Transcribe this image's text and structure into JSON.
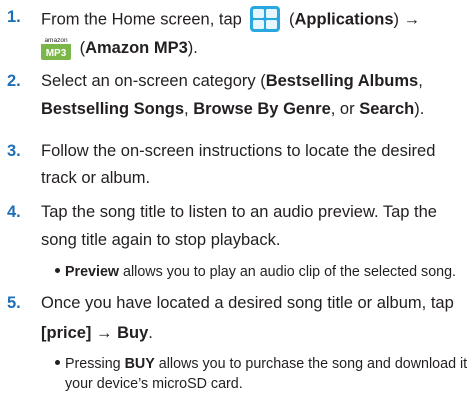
{
  "icons": {
    "applications": "applications-grid-icon",
    "amazon_mp3": "amazon-mp3-icon",
    "amazon_mp3_top": "amazon",
    "amazon_mp3_bottom": "MP3"
  },
  "colors": {
    "step_number": "#1f6fb6",
    "apps_icon_blue": "#29a8e0",
    "mp3_icon_green": "#7ab648"
  },
  "steps": [
    {
      "number": "1.",
      "l1_a": "From the Home screen, tap ",
      "l1_b": " (",
      "l1_bold": "Applications",
      "l1_c": ") →",
      "l2_a": " (",
      "l2_bold": "Amazon MP3",
      "l2_c": ")."
    },
    {
      "number": "2.",
      "l1_a": "Select an on-screen category (",
      "l1_bold": "Bestselling Albums",
      "l1_c": ",",
      "l2_bold1": "Bestselling Songs",
      "l2_a": ", ",
      "l2_bold2": "Browse By Genre",
      "l2_b": ", or ",
      "l2_bold3": "Search",
      "l2_c": ")."
    },
    {
      "number": "3.",
      "l1": "Follow the on-screen instructions to locate the desired",
      "l2": "track or album."
    },
    {
      "number": "4.",
      "l1": "Tap the song title to listen to an audio preview. Tap the",
      "l2": "song title again to stop playback.",
      "bullet_bold": "Preview",
      "bullet_text": " allows you to play an audio clip of the selected song."
    },
    {
      "number": "5.",
      "l1": "Once you have located a desired song title or album, tap",
      "l2_bold": "[price]",
      "l2_a": " → ",
      "l2_bold2": "Buy",
      "l2_b": ".",
      "bullet_a": "Pressing ",
      "bullet_bold": "BUY",
      "bullet_text": " allows you to purchase the song and download it to",
      "bullet_l2": "your device’s microSD card."
    }
  ]
}
